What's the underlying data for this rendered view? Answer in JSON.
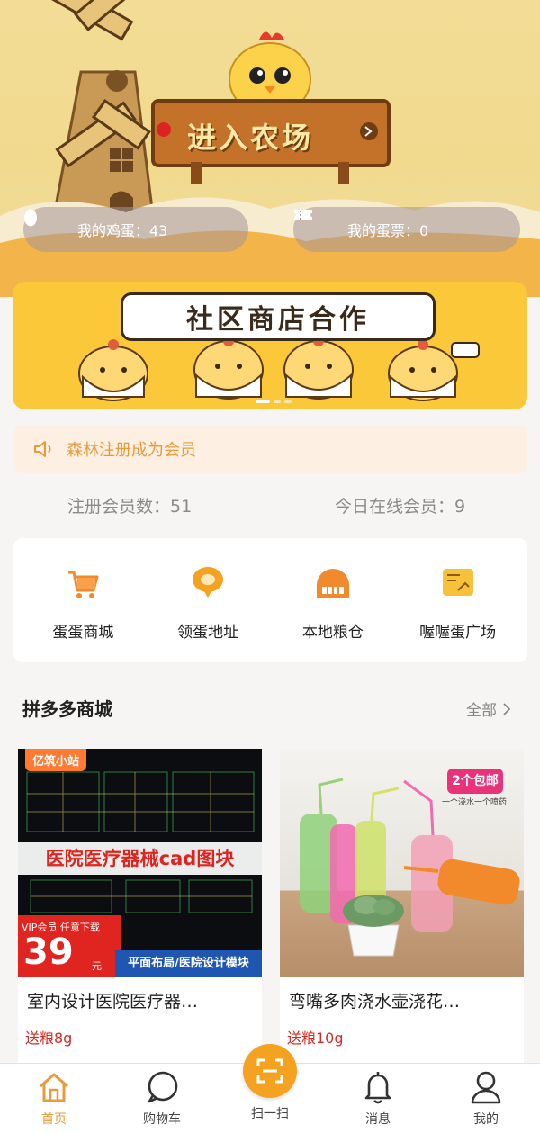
{
  "hero": {
    "sign_text": "进入农场",
    "eggs_label": "我的鸡蛋：43",
    "tickets_label": "我的蛋票：0"
  },
  "banner": {
    "title": "社区商店合作"
  },
  "notice": {
    "text": "森林注册成为会员"
  },
  "member_stats": {
    "registered": "注册会员数：51",
    "online_today": "今日在线会员：9"
  },
  "menu": [
    {
      "label": "蛋蛋商城",
      "icon": "cart-icon"
    },
    {
      "label": "领蛋地址",
      "icon": "location-pin-icon"
    },
    {
      "label": "本地粮仓",
      "icon": "granary-icon"
    },
    {
      "label": "喔喔蛋广场",
      "icon": "square-board-icon"
    }
  ],
  "section": {
    "title": "拼多多商城",
    "more": "全部"
  },
  "products": [
    {
      "title": "室内设计医院医疗器…",
      "reward": "送粮8g",
      "image": {
        "tag": "亿筑小站",
        "headline": "医院医疗器械cad图块",
        "vip": "VIP会员  任意下载",
        "price": "39",
        "unit": "元",
        "strip": "平面布局/医院设计模块"
      }
    },
    {
      "title": "弯嘴多肉浇水壶浇花…",
      "reward": "送粮10g",
      "image": {
        "badge": "2个包邮",
        "sub": "一个浇水一个喷药"
      }
    }
  ],
  "tabbar": {
    "home": "首页",
    "cart": "购物车",
    "scan": "扫一扫",
    "messages": "消息",
    "me": "我的"
  },
  "colors": {
    "accent": "#e99a3b",
    "scan": "#f4a21f",
    "reward": "#d42a22",
    "banner": "#fbc83a"
  }
}
